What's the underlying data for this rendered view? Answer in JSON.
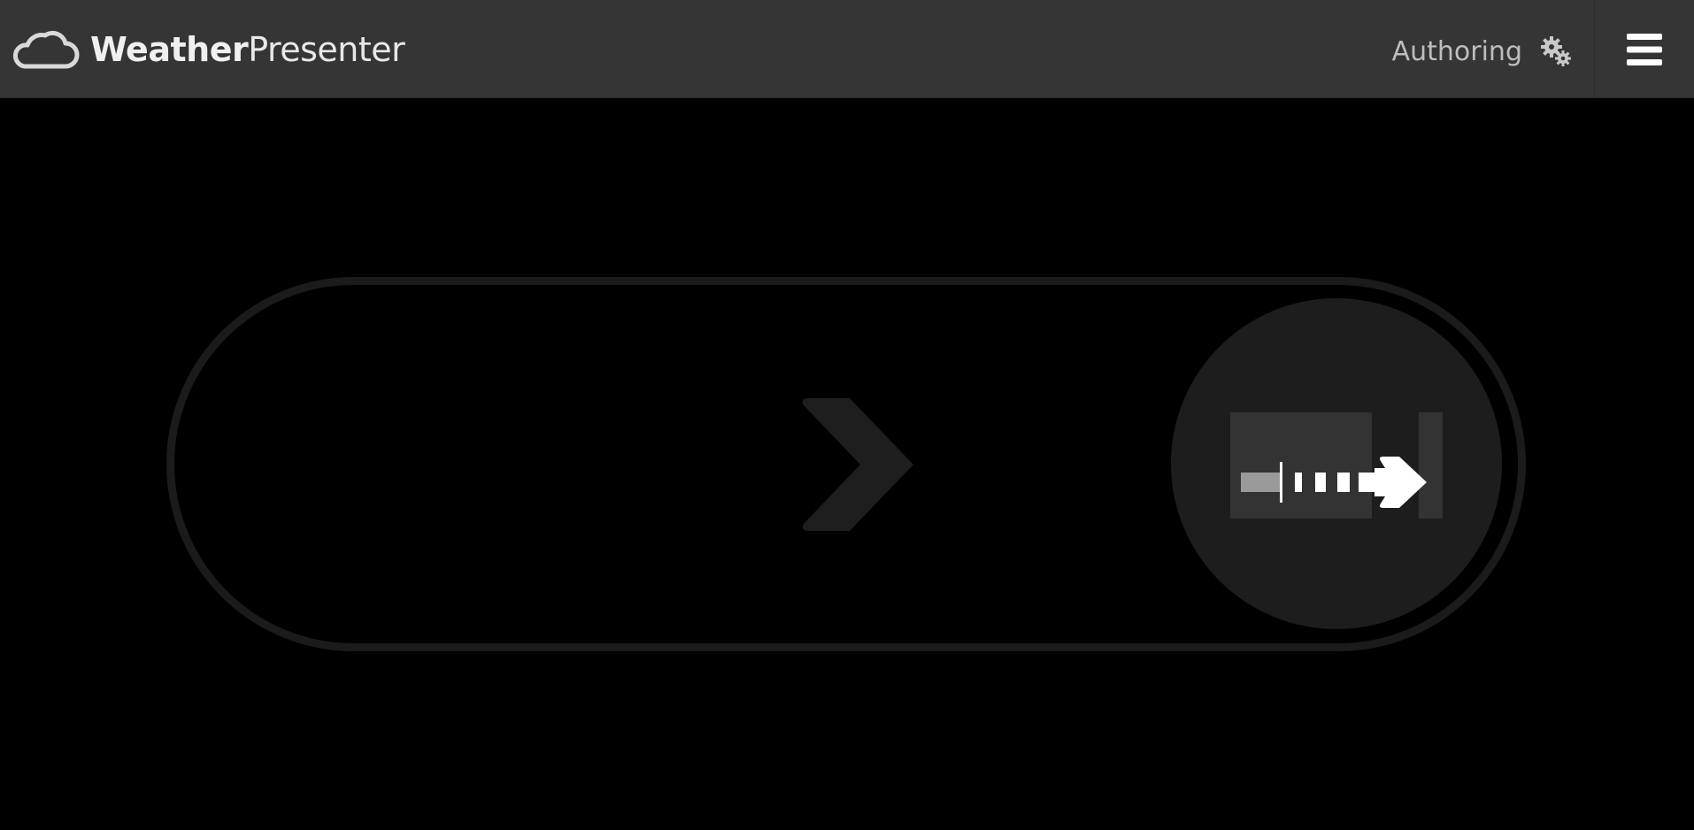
{
  "app": {
    "brand_strong": "Weather",
    "brand_light": "Presenter",
    "logo_icon": "cloud-icon"
  },
  "header": {
    "mode_label": "Authoring",
    "mode_icon": "gears-icon",
    "menu_icon": "hamburger-menu-icon"
  },
  "swipe_control": {
    "hint_icon": "chevron-right-icon",
    "knob_icon": "progress-arrow-icon",
    "colors": {
      "track_border": "#1b1b1b",
      "knob": "#1d1d1d",
      "chevron": "#1e1e1e"
    }
  },
  "colors": {
    "header_bg": "#353535",
    "page_bg": "#000000",
    "brand_text": "#f0f0f0",
    "mode_text": "#bdbdbd"
  }
}
